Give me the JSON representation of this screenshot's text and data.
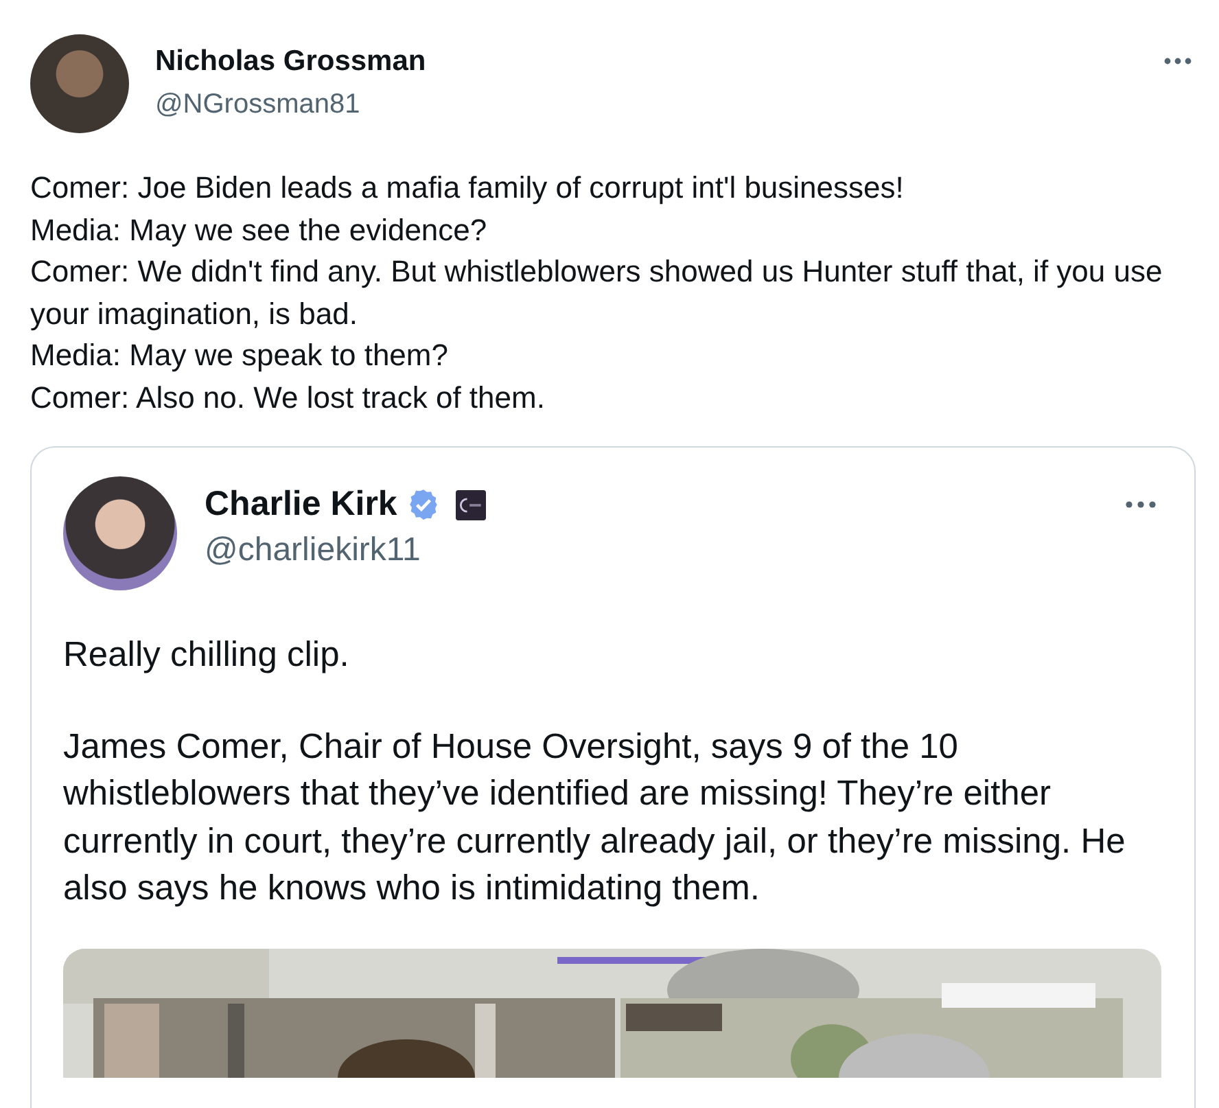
{
  "tweet": {
    "author": {
      "name": "Nicholas Grossman",
      "handle": "@NGrossman81"
    },
    "text_lines": [
      "Comer: Joe Biden leads a mafia family of corrupt int'l businesses!",
      "Media: May we see the evidence?",
      "Comer: We didn't find any. But whistleblowers showed us Hunter stuff that, if you use your imagination, is bad.",
      "Media: May we speak to them?",
      "Comer: Also no. We lost track of them."
    ],
    "quoted_tweet": {
      "author": {
        "name": "Charlie Kirk",
        "handle": "@charliekirk11",
        "verified": true,
        "affiliate_badge": true
      },
      "paragraphs": [
        "Really chilling clip.",
        "James Comer, Chair of House Oversight, says 9 of the 10 whistleblowers that they’ve identified are missing! They’re either currently in court, they’re currently already jail, or they’re missing. He also says he knows who is intimidating them."
      ]
    }
  }
}
